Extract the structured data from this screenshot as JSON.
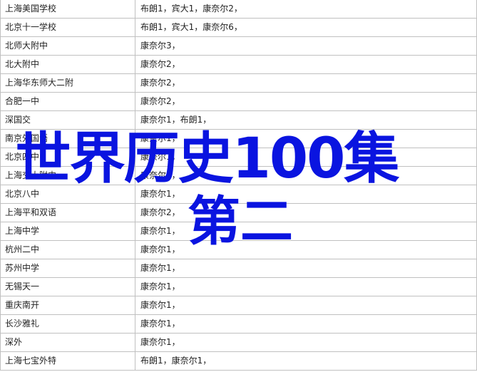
{
  "table": {
    "rows": [
      {
        "school": "上海美国学校",
        "players": "布朗1，宾大1，康奈尔2，"
      },
      {
        "school": "北京十一学校",
        "players": "布朗1，宾大1，康奈尔6，"
      },
      {
        "school": "北师大附中",
        "players": "康奈尔3，"
      },
      {
        "school": "北大附中",
        "players": "康奈尔2，"
      },
      {
        "school": "上海华东师大二附",
        "players": "康奈尔2，"
      },
      {
        "school": "合肥一中",
        "players": "康奈尔2，"
      },
      {
        "school": "深国交",
        "players": "康奈尔1，布朗1，"
      },
      {
        "school": "南京外国语",
        "players": "康奈尔1，"
      },
      {
        "school": "北京四中",
        "players": "康奈尔1，"
      },
      {
        "school": "上海交大附中",
        "players": "康奈尔1，"
      },
      {
        "school": "北京八中",
        "players": "康奈尔1，"
      },
      {
        "school": "上海平和双语",
        "players": "康奈尔2，"
      },
      {
        "school": "上海中学",
        "players": "康奈尔1，"
      },
      {
        "school": "杭州二中",
        "players": "康奈尔1，"
      },
      {
        "school": "苏州中学",
        "players": "康奈尔1，"
      },
      {
        "school": "无锡天一",
        "players": "康奈尔1，"
      },
      {
        "school": "重庆南开",
        "players": "康奈尔1，"
      },
      {
        "school": "长沙雅礼",
        "players": "康奈尔1，"
      },
      {
        "school": "深外",
        "players": "康奈尔1，"
      },
      {
        "school": "上海七宝外特",
        "players": "布朗1，康奈尔1，"
      }
    ]
  },
  "overlay": {
    "headline": "世界历史100集",
    "subline": "第二",
    "color": "#0a14e0"
  }
}
